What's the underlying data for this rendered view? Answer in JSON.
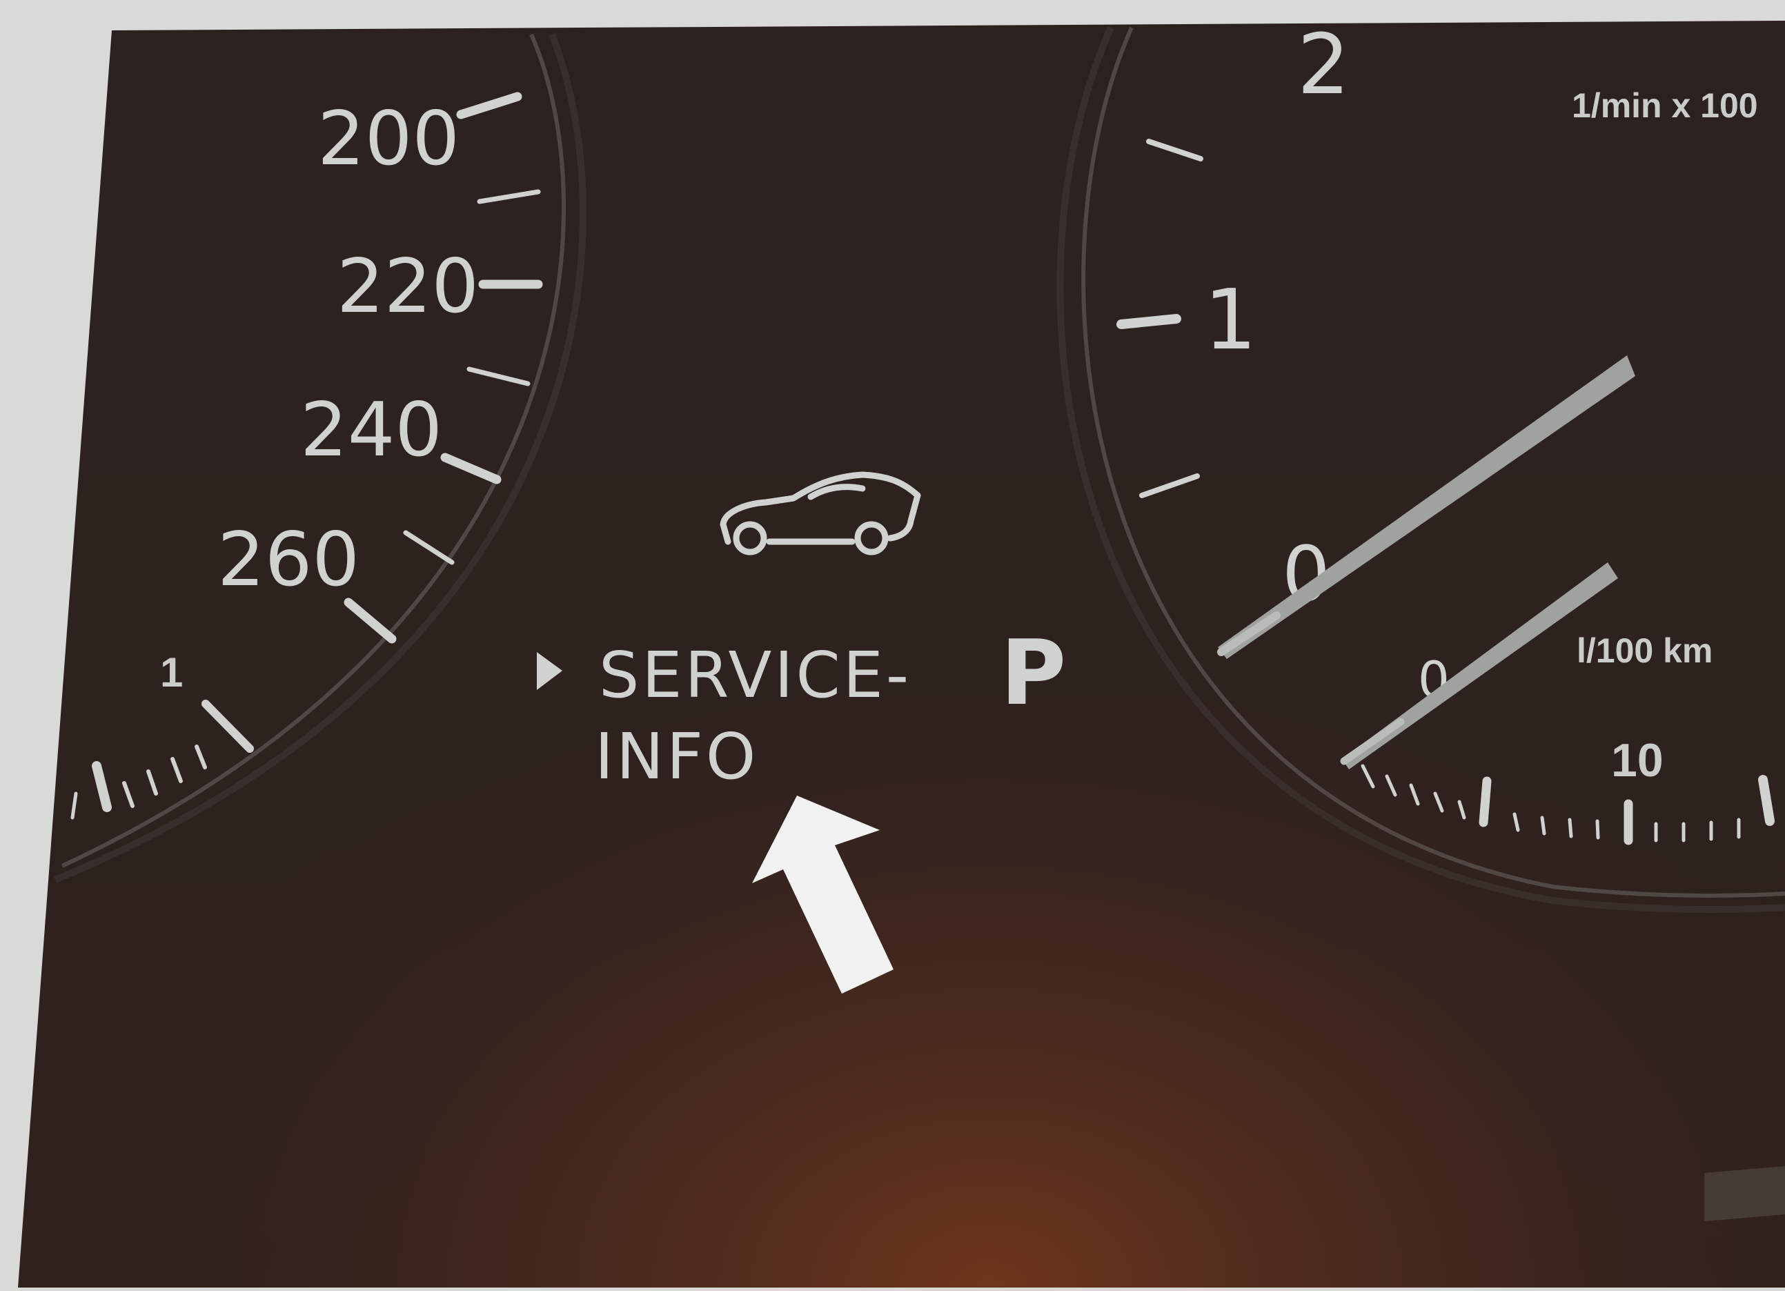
{
  "speedometer": {
    "labels": [
      "200",
      "220",
      "240",
      "260"
    ],
    "fuel_small_label": "1"
  },
  "center_display": {
    "icon": "car-icon",
    "indicator_icon": "right-triangle-icon",
    "message_line1": "SERVICE-",
    "message_line2": "INFO",
    "gear": "P"
  },
  "tachometer": {
    "labels": [
      "2",
      "1",
      "0"
    ],
    "unit": "1/min x 100",
    "consumption_unit": "l/100 km",
    "consumption_zero": "0",
    "consumption_scale": "10"
  },
  "annotation": {
    "icon": "pointer-arrow-icon",
    "arrow_color": "#f2f2f2"
  },
  "colors": {
    "panel": "#2a1e1c",
    "markings": "#cfd2cf",
    "page": "#d9dad7"
  }
}
